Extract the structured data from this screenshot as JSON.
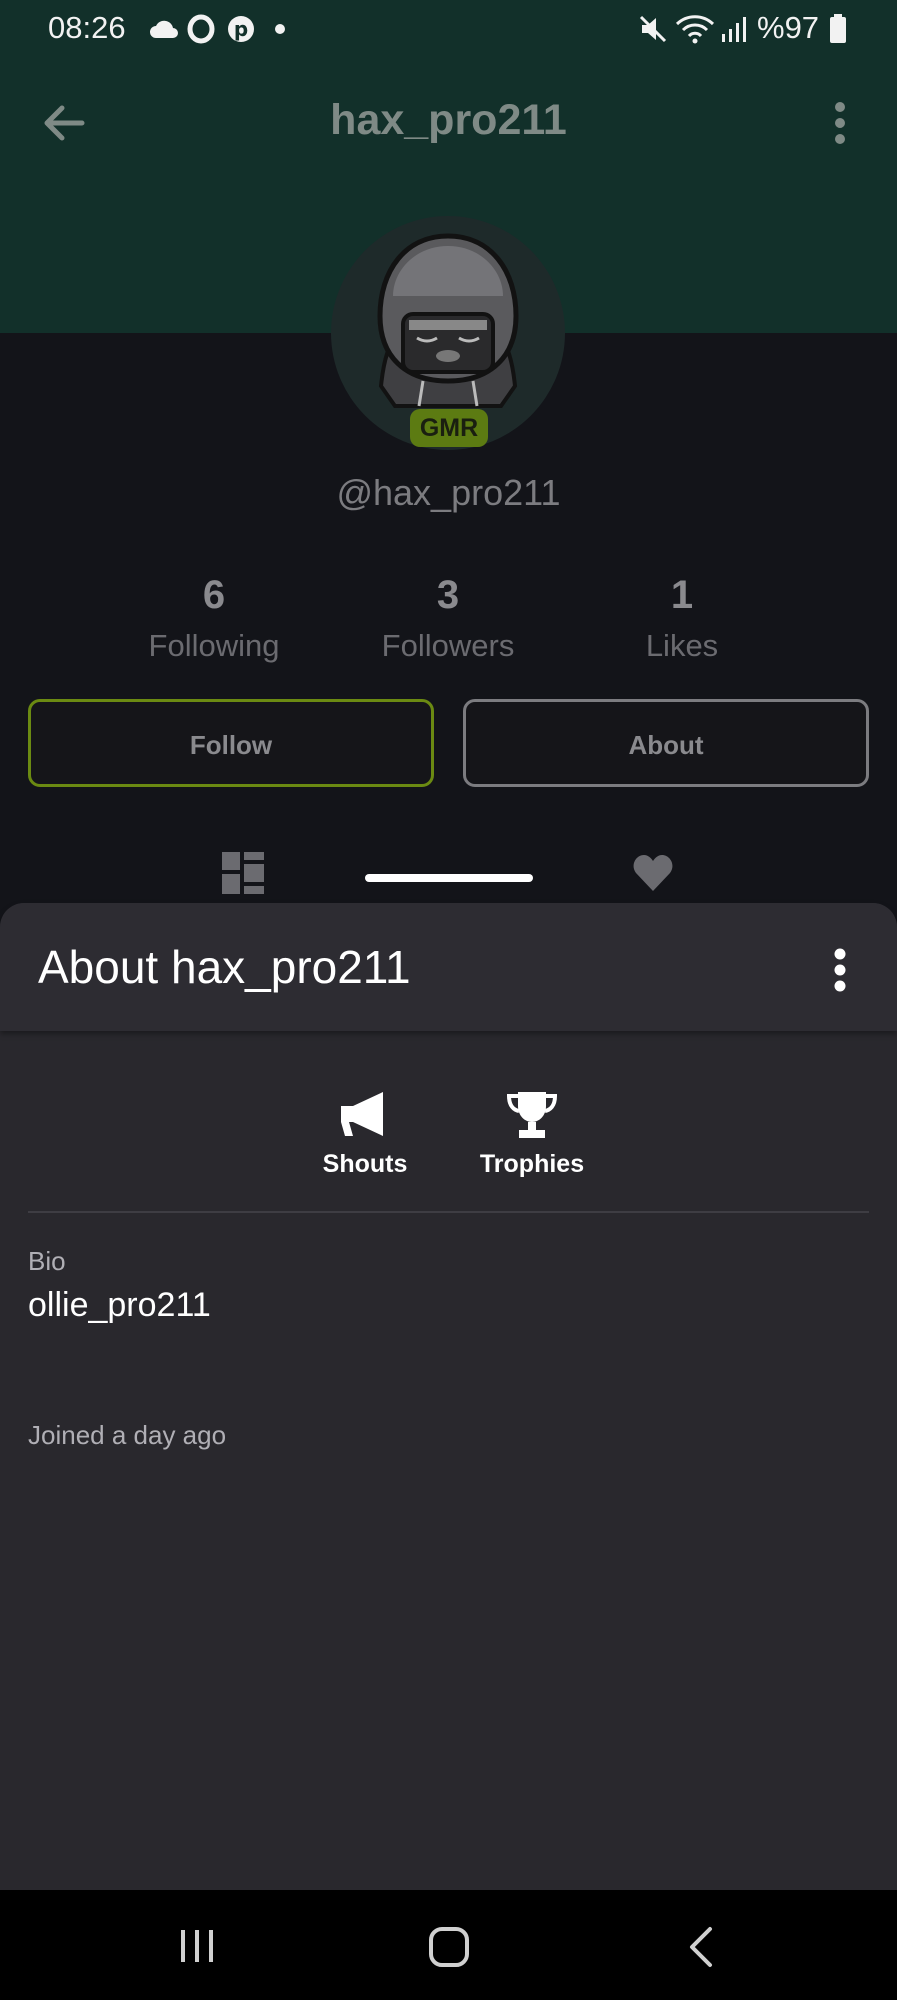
{
  "status_bar": {
    "time": "08:26",
    "battery": "%97",
    "icons": [
      "cloud-icon",
      "opera-icon",
      "pinterest-icon",
      "dot-icon",
      "mute-icon",
      "wifi-icon",
      "signal-icon",
      "battery-icon"
    ]
  },
  "app_bar": {
    "title": "hax_pro211",
    "back_icon": "arrow-left-icon",
    "more_icon": "more-vertical-icon"
  },
  "profile": {
    "badge": "GMR",
    "handle": "@hax_pro211",
    "stats": [
      {
        "value": "6",
        "label": "Following"
      },
      {
        "value": "3",
        "label": "Followers"
      },
      {
        "value": "1",
        "label": "Likes"
      }
    ],
    "follow_label": "Follow",
    "about_label": "About"
  },
  "sheet": {
    "title": "About hax_pro211",
    "tabs": [
      {
        "label": "Shouts",
        "icon": "megaphone-icon"
      },
      {
        "label": "Trophies",
        "icon": "trophy-icon"
      }
    ],
    "bio_label": "Bio",
    "bio_text": "ollie_pro211",
    "joined": "Joined a day ago"
  },
  "colors": {
    "header_bg": "#12302a",
    "body_bg": "#131419",
    "sheet_bg": "#29282d",
    "accent_green": "#6b8a12"
  }
}
